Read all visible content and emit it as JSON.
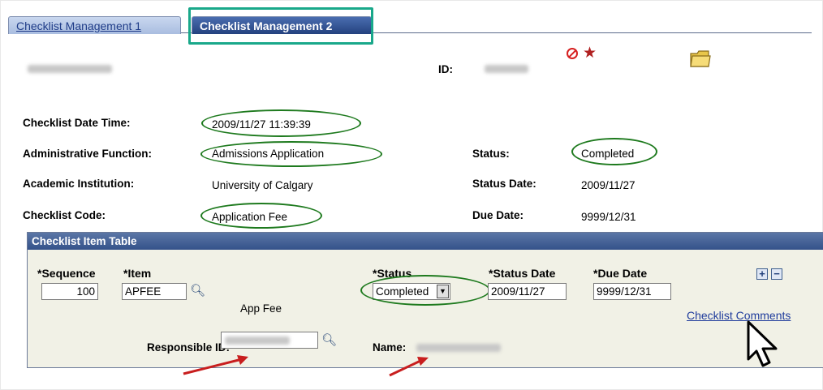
{
  "tabs": [
    {
      "label": "Checklist Management 1"
    },
    {
      "label": "Checklist Management 2"
    }
  ],
  "header": {
    "id_label": "ID:"
  },
  "fields": {
    "checklist_date_time": {
      "label": "Checklist Date Time:",
      "value": "2009/11/27 11:39:39"
    },
    "administrative_function": {
      "label": "Administrative Function:",
      "value": "Admissions Application"
    },
    "academic_institution": {
      "label": "Academic Institution:",
      "value": "University of Calgary"
    },
    "checklist_code": {
      "label": "Checklist Code:",
      "value": "Application Fee"
    },
    "status": {
      "label": "Status:",
      "value": "Completed"
    },
    "status_date": {
      "label": "Status Date:",
      "value": "2009/11/27"
    },
    "due_date": {
      "label": "Due Date:",
      "value": "9999/12/31"
    }
  },
  "item_table": {
    "title": "Checklist Item Table",
    "columns": {
      "sequence": "*Sequence",
      "item": "*Item",
      "status": "*Status",
      "status_date": "*Status Date",
      "due_date": "*Due Date"
    },
    "row": {
      "sequence": "100",
      "item": "APFEE",
      "item_desc": "App Fee",
      "status": "Completed",
      "status_date": "2009/11/27",
      "due_date": "9999/12/31"
    },
    "responsible_id_label": "Responsible ID:",
    "name_label": "Name:",
    "comments_link": "Checklist Comments",
    "add_button": "+",
    "remove_button": "−"
  },
  "colors": {
    "tab_highlight": "#19a88a",
    "callout_oval": "#1e7a1e",
    "arrow": "#c81e1e"
  }
}
